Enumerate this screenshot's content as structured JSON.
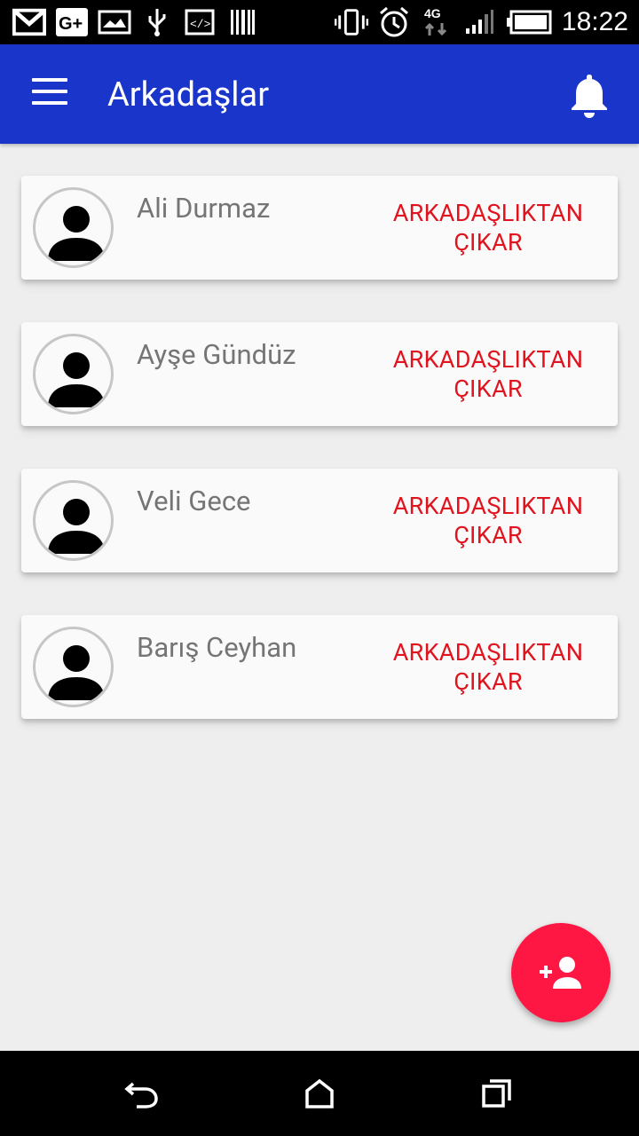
{
  "status_bar": {
    "time": "18:22",
    "network": "4G",
    "left_icons": [
      "gmail-icon",
      "google-plus-icon",
      "image-icon",
      "usb-icon",
      "code-icon",
      "barcode-icon"
    ],
    "right_icons": [
      "vibrate-icon",
      "alarm-icon",
      "network-4g-icon",
      "signal-icon",
      "battery-icon"
    ]
  },
  "app_bar": {
    "title": "Arkadaşlar",
    "menu_icon": "hamburger-menu-icon",
    "notification_icon": "bell-icon",
    "color": "#1a35c9"
  },
  "friends": [
    {
      "name": "Ali Durmaz",
      "action_line1": "ARKADAŞLIKTAN",
      "action_line2": "ÇIKAR"
    },
    {
      "name": "Ayşe Gündüz",
      "action_line1": "ARKADAŞLIKTAN",
      "action_line2": "ÇIKAR"
    },
    {
      "name": "Veli Gece",
      "action_line1": "ARKADAŞLIKTAN",
      "action_line2": "ÇIKAR"
    },
    {
      "name": "Barış Ceyhan",
      "action_line1": "ARKADAŞLIKTAN",
      "action_line2": "ÇIKAR"
    }
  ],
  "action_color": "#e0141e",
  "fab": {
    "icon": "add-person-icon",
    "color": "#ff1744"
  },
  "nav_bar": {
    "icons": [
      "back-icon",
      "home-icon",
      "recents-icon"
    ]
  }
}
